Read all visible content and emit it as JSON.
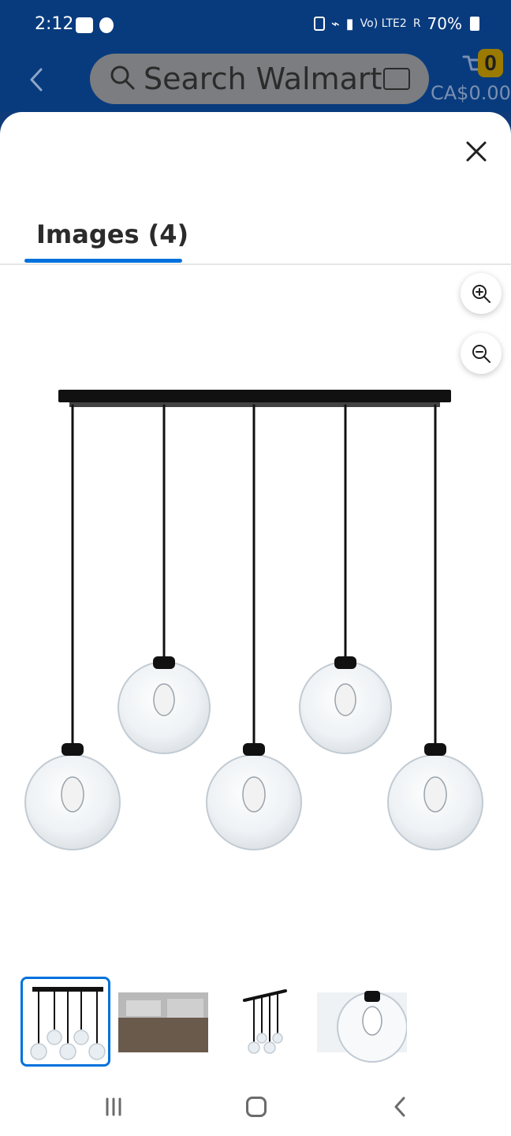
{
  "status": {
    "time": "2:12",
    "signal_text": "Vo) LTE2",
    "roaming": "R",
    "battery": "70%"
  },
  "header": {
    "search_placeholder": "Search Walmart",
    "cart_count": "0",
    "cart_total": "CA$0.00"
  },
  "sheet": {
    "tab_label": "Images (4)",
    "close_icon": "close-icon",
    "zoom_in_icon": "zoom-in-icon",
    "zoom_out_icon": "zoom-out-icon",
    "selected_thumbnail_index": 0
  },
  "thumbnails": [
    {
      "label": "product-pendant-light"
    },
    {
      "label": "room-scene"
    },
    {
      "label": "product-small"
    },
    {
      "label": "bulb-closeup"
    }
  ],
  "colors": {
    "brand_blue": "#0071dc",
    "header_bg": "#083b7e",
    "cart_badge": "#9a7a00"
  }
}
